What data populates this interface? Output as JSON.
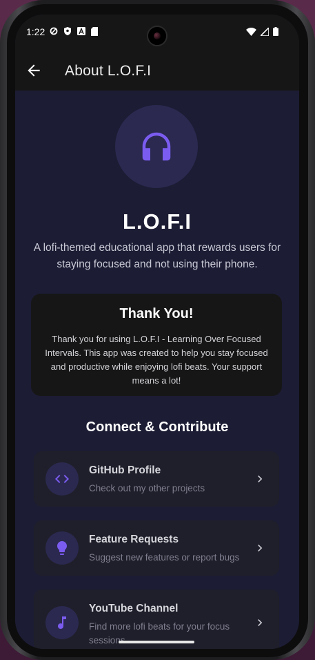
{
  "status": {
    "time": "1:22"
  },
  "appbar": {
    "title": "About L.O.F.I"
  },
  "hero": {
    "icon": "headphones-icon",
    "app_name": "L.O.F.I",
    "description": "A lofi-themed educational app that rewards users for staying focused and not using their phone."
  },
  "thanks": {
    "title": "Thank You!",
    "text": "Thank you for using L.O.F.I - Learning Over Focused Intervals. This app was created to help you stay focused and productive while enjoying lofi beats. Your support means a lot!"
  },
  "connect": {
    "title": "Connect & Contribute",
    "items": [
      {
        "title": "GitHub Profile",
        "subtitle": "Check out my other projects",
        "icon": "code-icon"
      },
      {
        "title": "Feature Requests",
        "subtitle": "Suggest new features or report bugs",
        "icon": "lightbulb-icon"
      },
      {
        "title": "YouTube Channel",
        "subtitle": "Find more lofi beats for your focus sessions",
        "icon": "music-note-icon"
      }
    ]
  },
  "colors": {
    "accent": "#7b5cf0",
    "background": "#1c1c34",
    "card": "#161617"
  }
}
